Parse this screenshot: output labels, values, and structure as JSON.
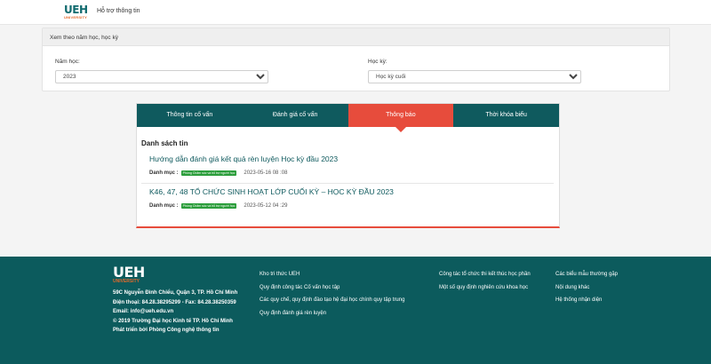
{
  "header": {
    "logo_text": "UEH",
    "logo_sub": "UNIVERSITY",
    "nav_link": "Hỗ trợ thông tin"
  },
  "filter": {
    "heading": "Xem theo năm học, học kỳ",
    "year_label": "Năm học:",
    "year_value": "2023",
    "semester_label": "Học kỳ:",
    "semester_value": "Học kỳ cuối"
  },
  "tabs": [
    "Thông tin cố vấn",
    "Đánh giá cố vấn",
    "Thông báo",
    "Thời khóa biểu"
  ],
  "active_tab": "Thông báo",
  "news": {
    "list_title": "Danh sách tin",
    "category_label": "Danh mục :",
    "items": [
      {
        "title": "Hướng dẫn đánh giá kết quả rèn luyện Học kỳ đầu 2023",
        "category": "Phòng Chăm sóc và hỗ trợ người học",
        "date": "2023-05-16 08 :08"
      },
      {
        "title": "K46, 47, 48 TỔ CHỨC SINH HOẠT LỚP CUỐI KỲ – HỌC KỲ ĐẦU 2023",
        "category": "Phòng Chăm sóc và hỗ trợ người học",
        "date": "2023-05-12 04 :29"
      }
    ]
  },
  "footer": {
    "logo_text": "UEH",
    "logo_sub": "UNIVERSITY",
    "address": "59C Nguyễn Đình Chiểu, Quận 3, TP. Hồ Chí Minh",
    "phone": "Điện thoại: 84.28.38295299 - Fax: 84.28.38250359",
    "email": "Email: info@ueh.edu.vn",
    "copyright": "© 2019 Trường Đại học Kinh tế TP. Hồ Chí Minh",
    "developer": "Phát triển bởi Phòng Công nghệ thông tin",
    "col1": [
      "Kho tri thức UEH",
      "Quy định công tác Cố vấn học tập",
      "Các quy chế, quy định đào tạo hệ đại học chính quy tập trung",
      "Quy định đánh giá rèn luyện"
    ],
    "col2": [
      "Công tác tổ chức thi kết thúc học phần",
      "Một số quy định nghiên cứu khoa học"
    ],
    "col3": [
      "Các biểu mẫu thường gặp",
      "Nội dung khác",
      "Hệ thống nhận diện"
    ]
  },
  "colors": {
    "brand_teal": "#0f5a5e",
    "accent_red": "#e74c3c",
    "badge_green": "#2a9d3a",
    "logo_orange": "#e26a2c"
  }
}
